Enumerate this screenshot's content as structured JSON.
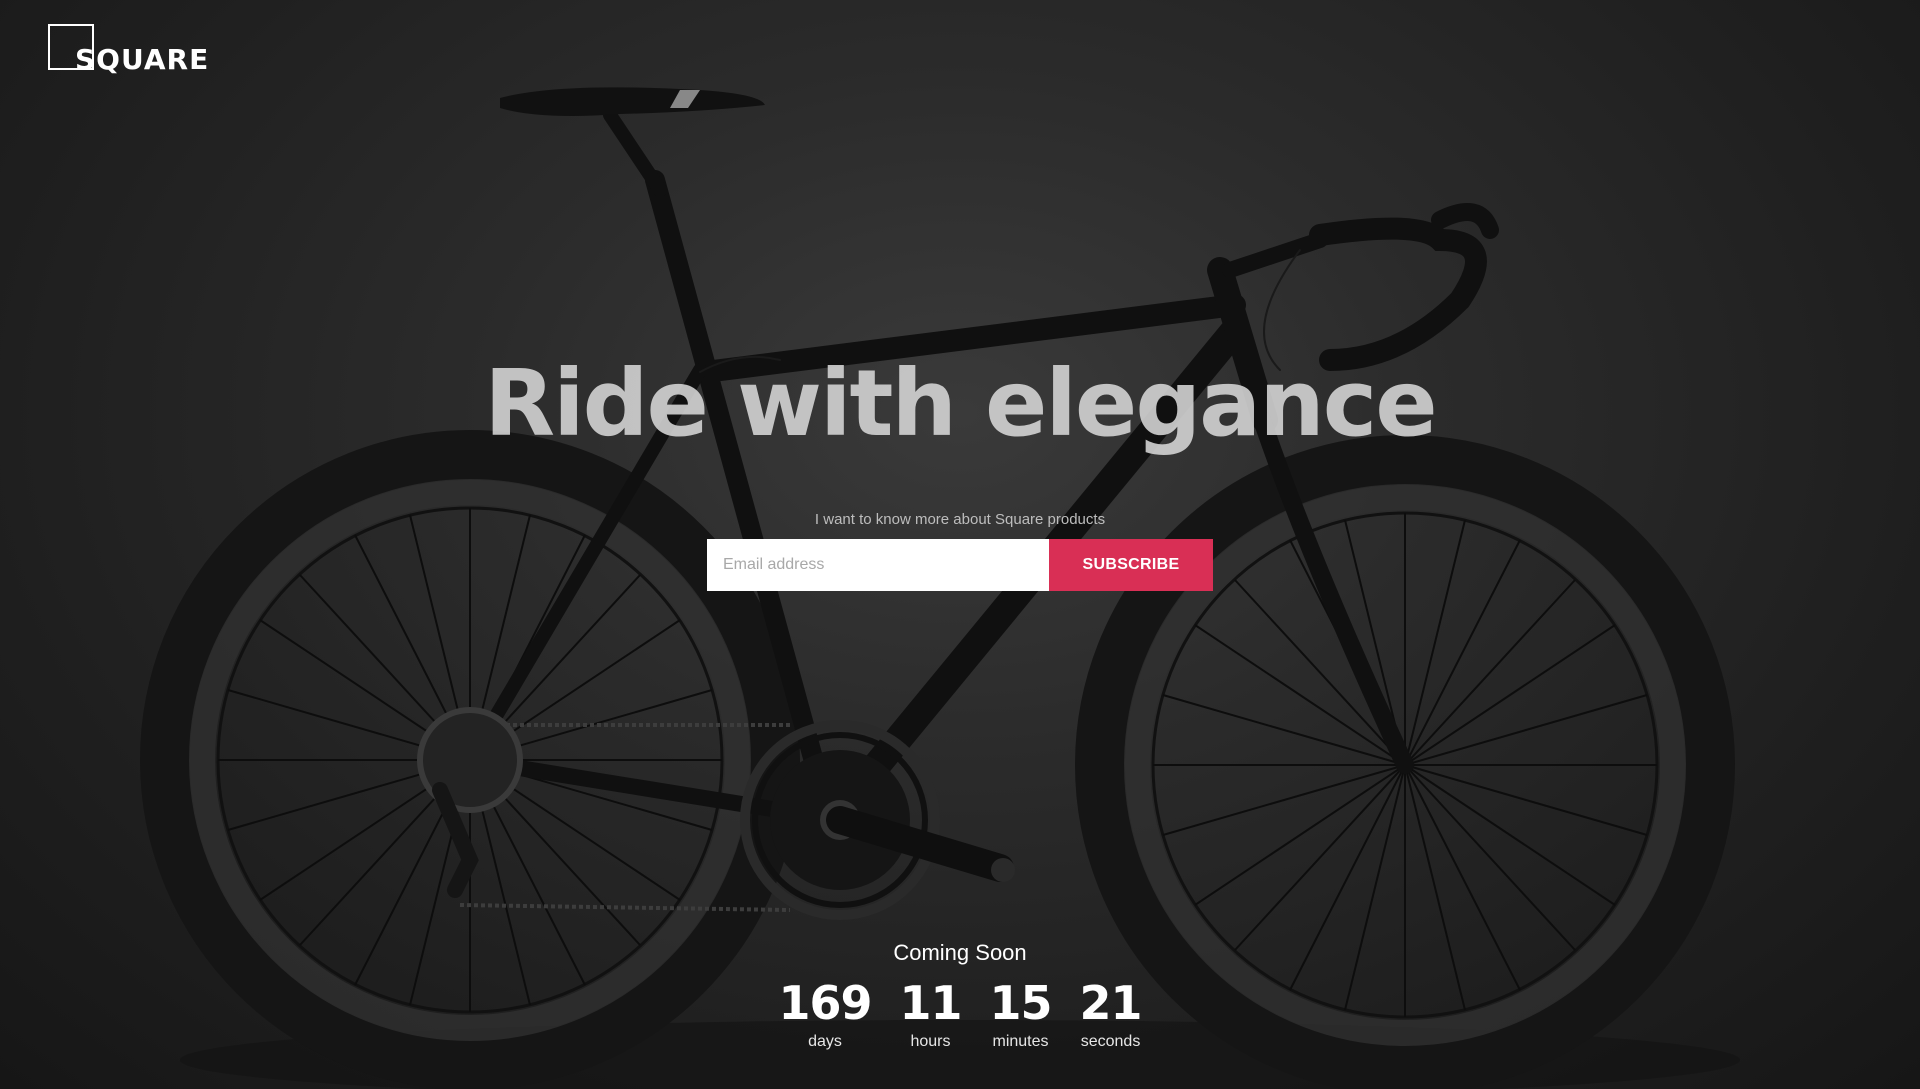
{
  "brand": {
    "name": "SQUARE"
  },
  "hero": {
    "headline": "Ride with elegance",
    "subtitle": "I want to know more about Square products",
    "image_icon": "road-bicycle-photo"
  },
  "signup": {
    "email_placeholder": "Email address",
    "email_value": "",
    "subscribe_label": "SUBSCRIBE"
  },
  "countdown": {
    "title": "Coming Soon",
    "units": [
      {
        "value": "169",
        "label": "days"
      },
      {
        "value": "11",
        "label": "hours"
      },
      {
        "value": "15",
        "label": "minutes"
      },
      {
        "value": "21",
        "label": "seconds"
      }
    ]
  },
  "colors": {
    "accent": "#d92f55",
    "background": "#1c1c1c",
    "text": "#ffffff"
  }
}
